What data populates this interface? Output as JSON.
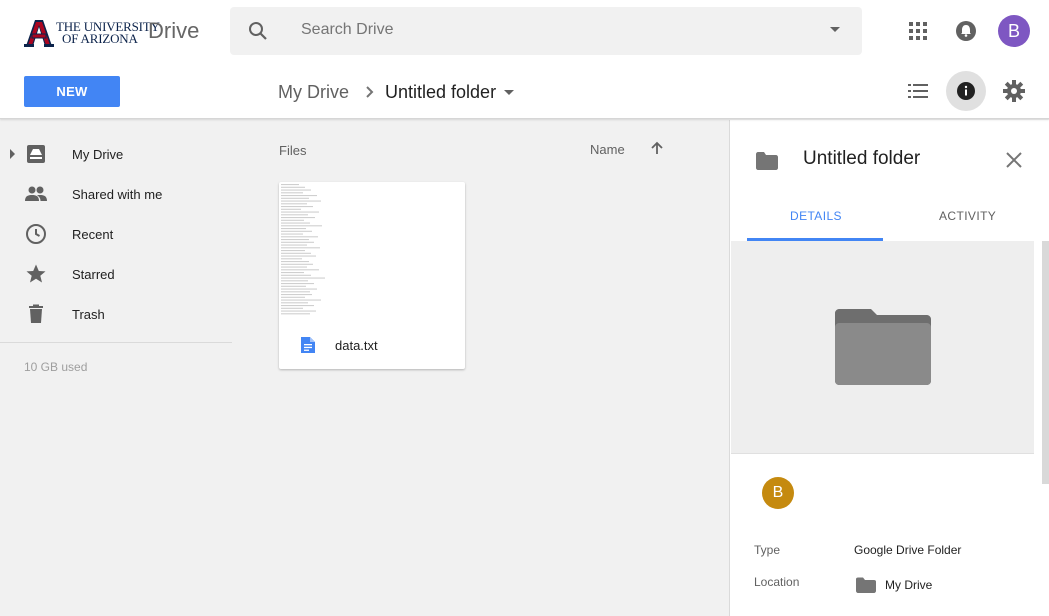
{
  "header": {
    "logo_line1": "THE UNIVERSITY",
    "logo_line2": "OF ARIZONA",
    "app_name": "Drive",
    "search_placeholder": "Search Drive",
    "avatar_initial": "B"
  },
  "toolbar": {
    "new_label": "NEW",
    "breadcrumb": [
      "My Drive",
      "Untitled folder"
    ]
  },
  "sidebar": {
    "items": [
      {
        "label": "My Drive",
        "icon": "drive-icon"
      },
      {
        "label": "Shared with me",
        "icon": "people-icon"
      },
      {
        "label": "Recent",
        "icon": "clock-icon"
      },
      {
        "label": "Starred",
        "icon": "star-icon"
      },
      {
        "label": "Trash",
        "icon": "trash-icon"
      }
    ],
    "storage": "10 GB used"
  },
  "main": {
    "section_label": "Files",
    "sort_label": "Name",
    "files": [
      {
        "name": "data.txt",
        "icon": "doc-icon"
      }
    ]
  },
  "details": {
    "title": "Untitled folder",
    "tabs": [
      "DETAILS",
      "ACTIVITY"
    ],
    "owner_initial": "B",
    "type_label": "Type",
    "type_value": "Google Drive Folder",
    "location_label": "Location",
    "location_value": "My Drive"
  },
  "colors": {
    "accent": "#4285f4",
    "avatar_top": "#7e57c2",
    "avatar_owner": "#c58a0f",
    "brand_navy": "#0c234b",
    "brand_red": "#ab0520"
  }
}
